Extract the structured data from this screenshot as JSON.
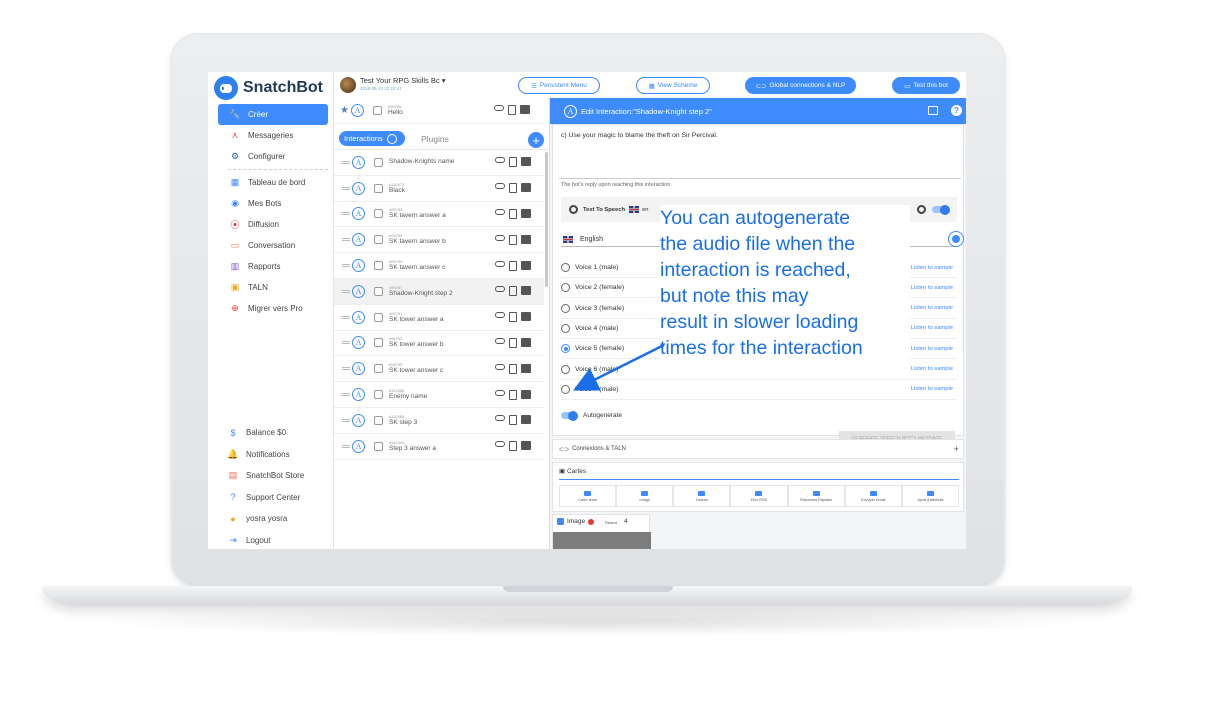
{
  "brand": {
    "name": "SnatchBot"
  },
  "nav": {
    "items": [
      {
        "label": "Créer",
        "icon": "wrench-icon",
        "glyph": "🔧",
        "color": "#3d8bfd",
        "active": true
      },
      {
        "label": "Messageries",
        "icon": "share-nodes-icon",
        "glyph": "⋏",
        "color": "#e53935"
      },
      {
        "label": "Configurer",
        "icon": "gear-icon",
        "glyph": "⚙",
        "color": "#1f5fbf"
      }
    ],
    "items2": [
      {
        "label": "Tableau de bord",
        "icon": "dashboard-icon",
        "glyph": "▦",
        "color": "#3d8bfd"
      },
      {
        "label": "Mes Bots",
        "icon": "bot-icon",
        "glyph": "◉",
        "color": "#3d8bfd"
      },
      {
        "label": "Diffusion",
        "icon": "broadcast-icon",
        "glyph": "⦿",
        "color": "#e53935"
      },
      {
        "label": "Conversation",
        "icon": "chat-icon",
        "glyph": "▭",
        "color": "#ef6c4a"
      },
      {
        "label": "Rapports",
        "icon": "bar-chart-icon",
        "glyph": "▥",
        "color": "#7e57c2"
      },
      {
        "label": "TALN",
        "icon": "grid-icon",
        "glyph": "▣",
        "color": "#f5a623"
      },
      {
        "label": "Migrer vers Pro",
        "icon": "plus-circle-icon",
        "glyph": "⊕",
        "color": "#e53935"
      }
    ],
    "bottom": [
      {
        "label": "Balance $0",
        "icon": "dollar-icon",
        "glyph": "$",
        "color": "#3d8bfd"
      },
      {
        "label": "Notifications",
        "icon": "bell-icon",
        "glyph": "🔔",
        "color": "#e53935"
      },
      {
        "label": "SnatchBot Store",
        "icon": "store-icon",
        "glyph": "▤",
        "color": "#ef6c4a"
      },
      {
        "label": "Support Center",
        "icon": "help-icon",
        "glyph": "?",
        "color": "#3d8bfd"
      },
      {
        "label": "yosra yosra",
        "icon": "user-icon",
        "glyph": "●",
        "color": "#f5a623"
      },
      {
        "label": "Logout",
        "icon": "logout-icon",
        "glyph": "⇥",
        "color": "#3d8bfd"
      }
    ]
  },
  "topbar": {
    "bot_name": "Test Your RPG Skills Bc",
    "bot_date": "2018-08-13 22:22:47",
    "persistent_menu": "Persistent Menu",
    "view_scheme": "View Scheme",
    "global_connections": "Global connections & NLP",
    "test_bot": "Test this bot"
  },
  "interactions": {
    "tab_interactions": "Interactions",
    "tab_count": "",
    "tab_plugins": "Plugins",
    "first_row": {
      "id": "#95796",
      "name": "Hello"
    },
    "rows": [
      {
        "id": "",
        "name": "Shadow-Knights name"
      },
      {
        "id": "#116473",
        "name": "Black"
      },
      {
        "id": "#95788",
        "name": "SK tavern answer a"
      },
      {
        "id": "#95789",
        "name": "SK tavern answer b"
      },
      {
        "id": "#95790",
        "name": "SK tavern answer c"
      },
      {
        "id": "#95787",
        "name": "Shadow-Knight step 2",
        "selected": true
      },
      {
        "id": "#95791",
        "name": "SK tower answer a"
      },
      {
        "id": "#95792",
        "name": "SK tower answer b"
      },
      {
        "id": "#95795",
        "name": "SK tower answer c"
      },
      {
        "id": "#112086",
        "name": "Enemy name"
      },
      {
        "id": "#112085",
        "name": "SK step 3"
      },
      {
        "id": "#112443",
        "name": "Step 3 answer a"
      }
    ]
  },
  "editor": {
    "title": "Edit Interaction:\"Shadow-Knight step 2\"",
    "message": "c) Use your magic to blame the theft on Sir Percival.",
    "hint": "The bot's reply upon reaching this interaction.",
    "tts_label": "Text To Speech",
    "tts_lang": "en",
    "language": "English",
    "voices": [
      {
        "label": "Voice 1 (male)",
        "selected": false
      },
      {
        "label": "Voice 2 (female)",
        "selected": false
      },
      {
        "label": "Voice 3 (female)",
        "selected": false
      },
      {
        "label": "Voice 4 (male)",
        "selected": false
      },
      {
        "label": "Voice 5 (female)",
        "selected": true
      },
      {
        "label": "Voice 6 (male)",
        "selected": false
      },
      {
        "label": "Voice 7 (male)",
        "selected": false
      }
    ],
    "listen_label": "Listen to sample",
    "autogenerate": "Autogenerate",
    "generate_button": "GENERATE SPEECH BOT'S MESSAGE",
    "connections": "Connexions & TALN",
    "cards_title": "Cartes",
    "card_tabs": [
      "Carte texte",
      "Image",
      "Galerie",
      "Flux RSS",
      "Réponses Rapides",
      "Envoyer Email",
      "Ajout d'attributs"
    ],
    "image_title": "Image",
    "retard_label": "Retard",
    "retard_value": "4"
  },
  "annotation": {
    "lines": [
      "You can autogenerate",
      "the audio file when the",
      "interaction is reached,",
      "but note this may",
      "result in slower loading",
      "times for the interaction"
    ],
    "color": "#1a6fe8"
  }
}
